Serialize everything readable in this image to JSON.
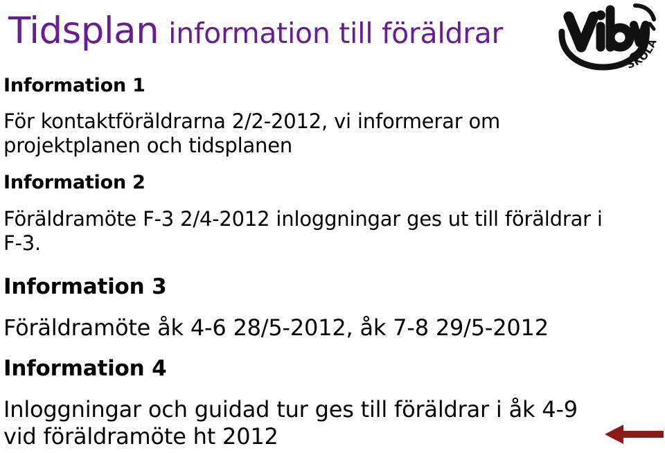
{
  "slide": {
    "background_color": "#ffffff",
    "title": {
      "main": "Tidsplan",
      "sub": "information till föräldrar",
      "color": "#6a1b9a"
    },
    "logo": {
      "name": "viby-skolan-logo",
      "wordmark": "Viby",
      "subtext": "SKOLAN",
      "color": "#111111"
    },
    "sections": [
      {
        "heading": "Information 1",
        "lines": [
          "För kontaktföräldrarna 2/2-2012, vi informerar om",
          "projektplanen och tidsplanen"
        ]
      },
      {
        "heading": "Information 2",
        "lines": [
          "Föräldramöte F-3 2/4-2012 inloggningar ges ut till föräldrar i",
          "F-3."
        ]
      },
      {
        "heading": "Information 3",
        "lines": [
          "Föräldramöte åk 4-6 28/5-2012, åk 7-8 29/5-2012"
        ]
      },
      {
        "heading": "Information 4",
        "lines": [
          "Inloggningar och guidad tur ges till föräldrar i åk 4-9",
          "vid föräldramöte ht 2012"
        ]
      }
    ],
    "arrow": {
      "name": "left-arrow-annotation",
      "direction": "left",
      "color": "#8b1a12"
    }
  }
}
